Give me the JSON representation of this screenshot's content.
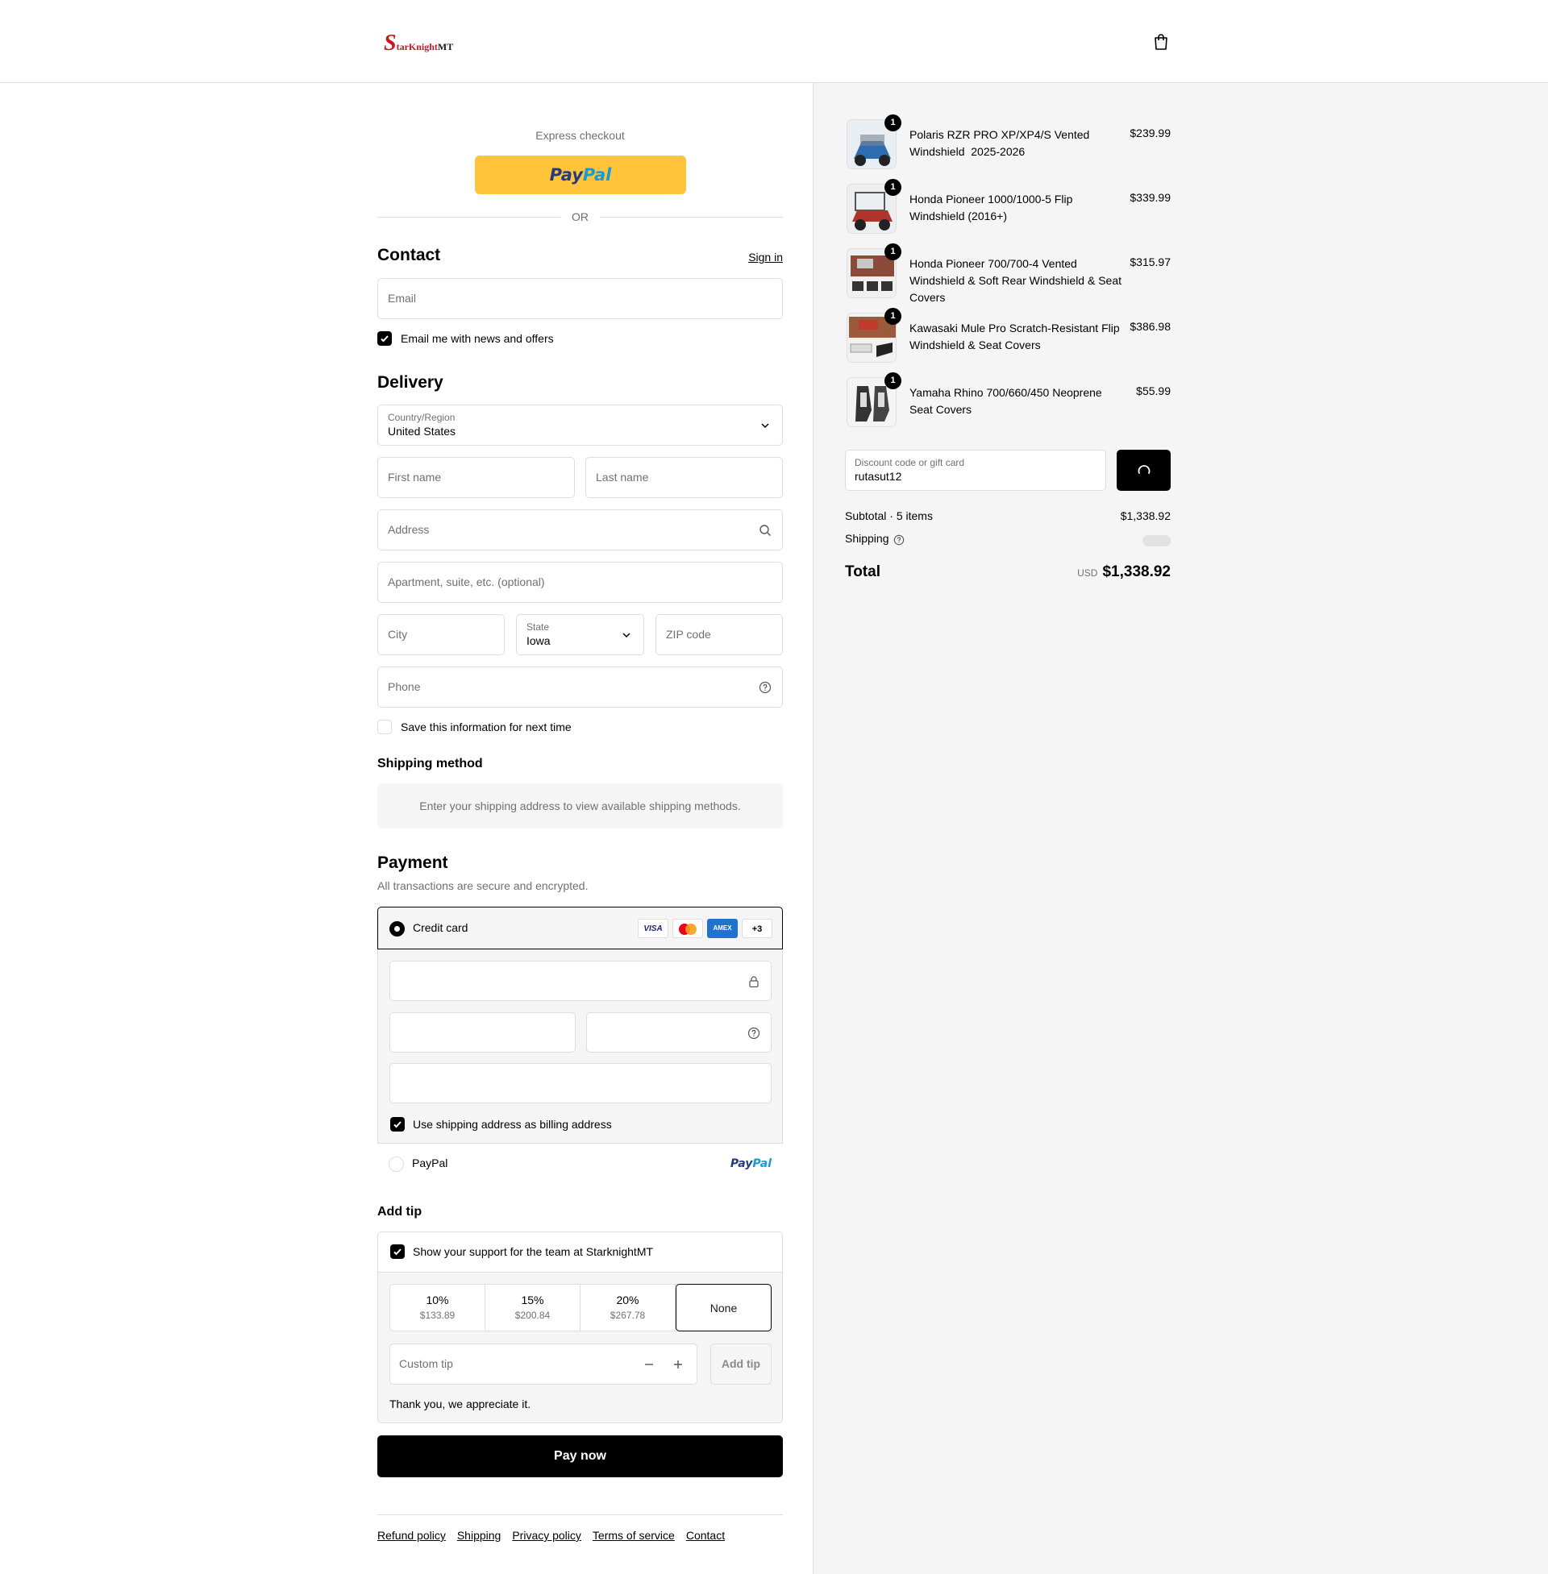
{
  "header": {
    "logo_s": "S",
    "logo_mid": "tarKnight",
    "logo_end": "MT",
    "cart_icon": "shopping-bag-icon"
  },
  "express": {
    "label": "Express checkout",
    "paypal_a": "Pay",
    "paypal_b": "Pal",
    "or": "OR"
  },
  "contact": {
    "title": "Contact",
    "sign_in": "Sign in",
    "email_placeholder": "Email",
    "news_label": "Email me with news and offers",
    "news_checked": true
  },
  "delivery": {
    "title": "Delivery",
    "country_label": "Country/Region",
    "country_value": "United States",
    "first_name": "First name",
    "last_name": "Last name",
    "address": "Address",
    "apartment": "Apartment, suite, etc. (optional)",
    "city": "City",
    "state_label": "State",
    "state_value": "Iowa",
    "zip": "ZIP code",
    "phone": "Phone",
    "save_label": "Save this information for next time",
    "save_checked": false
  },
  "shipping_method": {
    "title": "Shipping method",
    "message": "Enter your shipping address to view available shipping methods."
  },
  "payment": {
    "title": "Payment",
    "subtitle": "All transactions are secure and encrypted.",
    "credit_card_label": "Credit card",
    "card_brands": [
      "VISA",
      "Mastercard",
      "AMEX"
    ],
    "more_brands": "+3",
    "billing_label": "Use shipping address as billing address",
    "billing_checked": true,
    "paypal_label": "PayPal",
    "paypal_a": "Pay",
    "paypal_b": "Pal"
  },
  "tip": {
    "title": "Add tip",
    "support_label": "Show your support for the team at StarknightMT",
    "support_checked": true,
    "options": [
      {
        "pct": "10%",
        "amt": "$133.89"
      },
      {
        "pct": "15%",
        "amt": "$200.84"
      },
      {
        "pct": "20%",
        "amt": "$267.78"
      }
    ],
    "none_label": "None",
    "custom_placeholder": "Custom tip",
    "add_button": "Add tip",
    "thanks": "Thank you, we appreciate it."
  },
  "pay_now": "Pay now",
  "footer": {
    "links": [
      "Refund policy",
      "Shipping",
      "Privacy policy",
      "Terms of service",
      "Contact"
    ]
  },
  "cart": {
    "items": [
      {
        "name": "Polaris RZR PRO XP/XP4/S Vented Windshield  2025-2026 ",
        "price": "$239.99",
        "qty": "1"
      },
      {
        "name": "Honda Pioneer 1000/1000-5 Flip Windshield (2016+)",
        "price": "$339.99",
        "qty": "1"
      },
      {
        "name": "Honda Pioneer 700/700-4 Vented Windshield & Soft Rear Windshield & Seat Covers",
        "price": "$315.97",
        "qty": "1"
      },
      {
        "name": "Kawasaki Mule Pro Scratch-Resistant Flip Windshield & Seat Covers",
        "price": "$386.98",
        "qty": "1"
      },
      {
        "name": "Yamaha Rhino 700/660/450 Neoprene Seat Covers",
        "price": "$55.99",
        "qty": "1"
      }
    ],
    "discount_label": "Discount code or gift card",
    "discount_value": "rutasut12",
    "subtotal_label": "Subtotal · 5 items",
    "subtotal_value": "$1,338.92",
    "shipping_label": "Shipping",
    "total_label": "Total",
    "currency": "USD",
    "total_value": "$1,338.92"
  }
}
